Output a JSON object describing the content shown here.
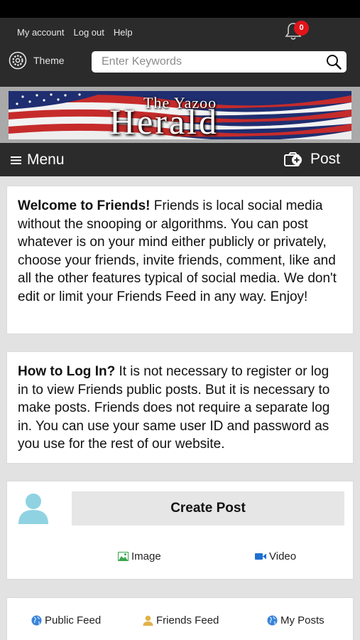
{
  "header": {
    "links": [
      "My account",
      "Log out",
      "Help"
    ],
    "notification_count": "0",
    "theme_label": "Theme",
    "search_placeholder": "Enter Keywords"
  },
  "banner": {
    "line1": "The Yazoo",
    "line2": "Herald"
  },
  "menubar": {
    "menu_label": "Menu",
    "post_label": "Post"
  },
  "welcome": {
    "heading": "Welcome to Friends!",
    "body": " Friends is local social media without the snooping or algorithms. You can post whatever is on your mind either publicly or privately, choose your friends, invite friends, comment, like and all the other features typical of social media. We don't edit or limit your Friends Feed in any way. Enjoy!"
  },
  "howto": {
    "heading": "How to Log In?",
    "body": " It is not necessary to register or log in to view Friends public posts. But it is necessary to make posts. Friends does not require a separate log in. You can use your same user ID and password as you use for the rest of our website."
  },
  "composer": {
    "create_label": "Create Post",
    "image_label": "Image",
    "video_label": "Video"
  },
  "feeds": {
    "public": "Public Feed",
    "friends": "Friends Feed",
    "mine": "My Posts"
  },
  "colors": {
    "topbar": "#2b2b2b",
    "badge": "#e1141a",
    "globe": "#3a83d6",
    "avatar": "#8fd3e3",
    "friends_icon": "#e2b24a"
  }
}
